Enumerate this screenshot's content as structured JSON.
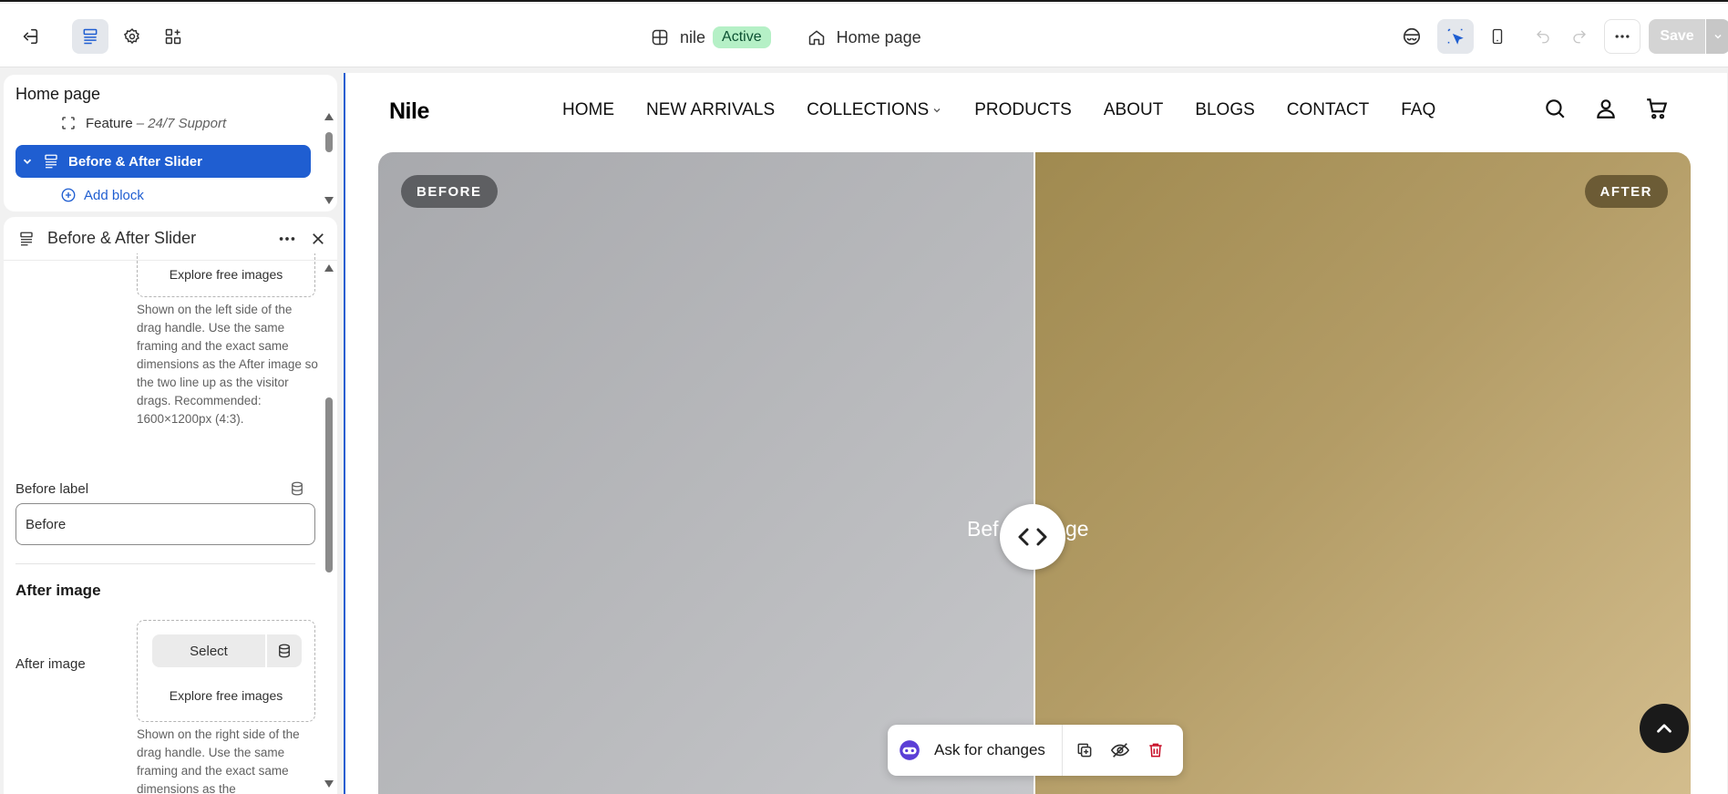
{
  "topbar": {
    "theme_name": "nile",
    "status_badge": "Active",
    "page_selector": "Home page",
    "save_label": "Save"
  },
  "sidebar": {
    "section_title": "Home page",
    "tree": {
      "feature_item": "Feature",
      "feature_detail": "– 24/7 Support",
      "selected_item": "Before & After Slider",
      "add_block": "Add block"
    },
    "settings": {
      "title": "Before & After Slider",
      "before_explore": "Explore free images",
      "before_help": "Shown on the left side of the drag handle. Use the same framing and the exact same dimensions as the After image so the two line up as the visitor drags. Recommended: 1600×1200px (4:3).",
      "before_label_title": "Before label",
      "before_label_value": "Before",
      "after_section": "After image",
      "after_image_label": "After image",
      "select_label": "Select",
      "after_explore": "Explore free images",
      "after_help": "Shown on the right side of the drag handle. Use the same framing and the exact same dimensions as the"
    }
  },
  "preview": {
    "store_name": "Nile",
    "menu": [
      "HOME",
      "NEW ARRIVALS",
      "COLLECTIONS",
      "PRODUCTS",
      "ABOUT",
      "BLOGS",
      "CONTACT",
      "FAQ"
    ],
    "slider": {
      "before_pill": "BEFORE",
      "after_pill": "AFTER",
      "center_text_left": "Bef",
      "center_text_right": "ge"
    },
    "ask_bar": {
      "label": "Ask for changes"
    }
  },
  "colors": {
    "accent": "#1f5ed1",
    "badge_bg": "#b5f0c6",
    "before_pill": "#5e5f63",
    "after_pill": "#6b5b35",
    "delete": "#c70a24"
  }
}
